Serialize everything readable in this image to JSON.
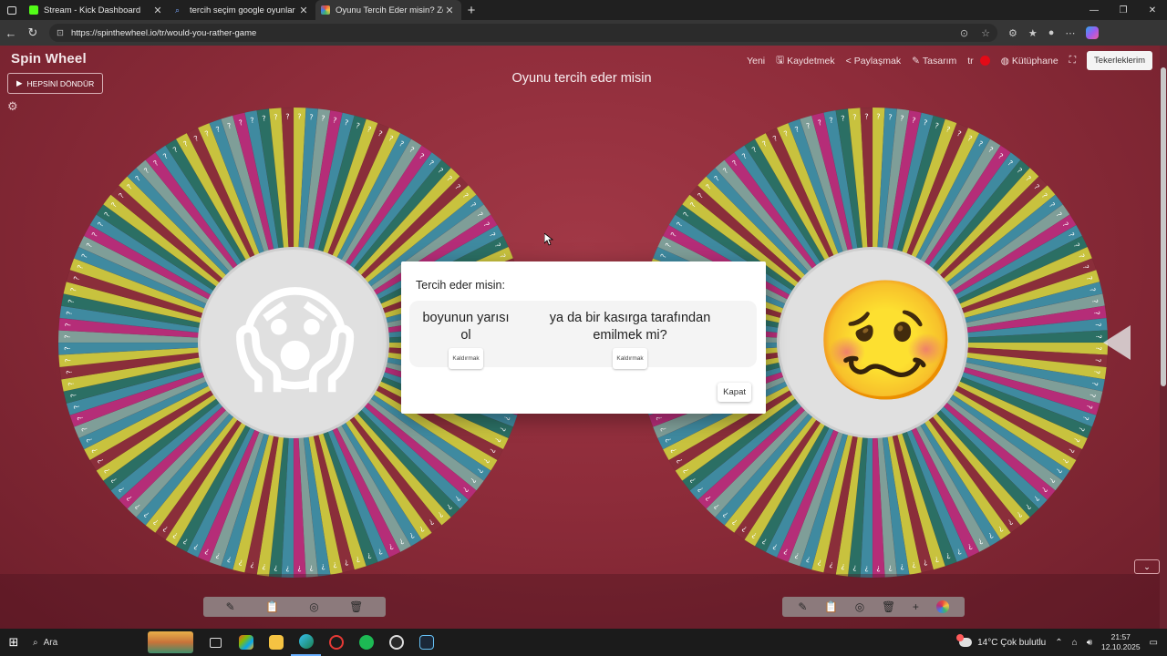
{
  "browser": {
    "tabs": [
      {
        "title": "Stream - Kick Dashboard",
        "favicon_color": "#53fc18",
        "active": false
      },
      {
        "title": "tercih seçim google oyunlar - Ara",
        "favicon_color": "#7aa7ff",
        "active": false
      },
      {
        "title": "Oyunu Tercih Eder misin? Zor",
        "favicon_color": "#e9a23b",
        "active": true
      }
    ],
    "url": "https://spinthewheel.io/tr/would-you-rather-game"
  },
  "app": {
    "logo": "Spin Wheel",
    "spin_all_label": "HEPSİNİ DÖNDÜR",
    "title": "Oyunu tercih eder misin",
    "menu": {
      "new": "Yeni",
      "save": "Kaydetmek",
      "share": "Paylaşmak",
      "design": "Tasarım",
      "language": "tr",
      "library": "Kütüphane",
      "my_wheels": "Tekerleklerim"
    }
  },
  "wheels": [
    {
      "emoji": "😱",
      "segment_label": "?",
      "colors": [
        "#c8c23e",
        "#3f8aa0",
        "#7f9e98",
        "#b52d78",
        "#3f8aa0",
        "#2b6f64",
        "#c8c23e",
        "#8a2e3a"
      ]
    },
    {
      "emoji": "🥴",
      "segment_label": "?",
      "colors": [
        "#c8c23e",
        "#3f8aa0",
        "#7f9e98",
        "#b52d78",
        "#3f8aa0",
        "#2b6f64",
        "#c8c23e",
        "#8a2e3a"
      ]
    }
  ],
  "dialog": {
    "title": "Tercih eder misin:",
    "option_a": "boyunun yarısı ol",
    "option_b": "ya da bir kasırga tarafından emilmek mi?",
    "remove_label": "Kaldırmak",
    "close_label": "Kapat"
  },
  "taskbar": {
    "search": "Ara",
    "weather": "14°C  Çok bulutlu",
    "time": "21:57",
    "date": "12.10.2025"
  }
}
